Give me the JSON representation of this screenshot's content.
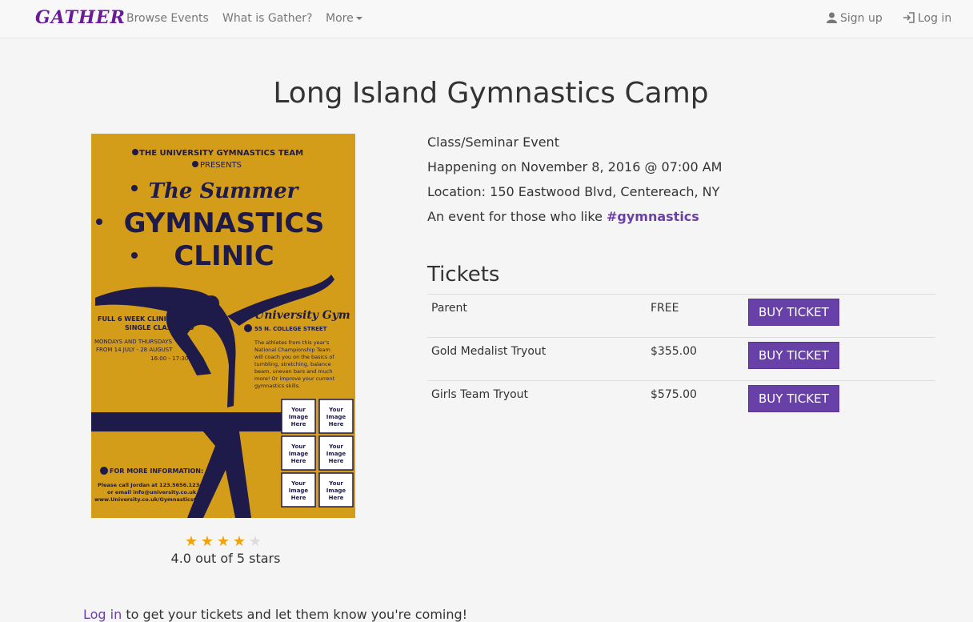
{
  "navbar": {
    "brand": "GATHER",
    "links": [
      "Browse Events",
      "What is Gather?",
      "More"
    ],
    "signup": "Sign up",
    "login": "Log in"
  },
  "event": {
    "title": "Long Island Gymnastics Camp",
    "category": "Class/Seminar Event",
    "happening": "Happening on November 8, 2016 @ 07:00 AM",
    "location": "Location: 150 Eastwood Blvd, Centereach, NY",
    "tag_prefix": "An event for those who like ",
    "tag": "#gymnastics"
  },
  "poster": {
    "line1": "THE UNIVERSITY GYMNASTICS TEAM",
    "line2": "PRESENTS",
    "line3": "The Summer",
    "line4": "GYMNASTICS",
    "line5": "CLINIC",
    "clinic1": "FULL 6 WEEK CLINIC: £100",
    "clinic2": "SINGLE CLASS: £10",
    "days1": "MONDAYS AND THURSDAYS",
    "days2": "FROM 14 JULY - 28 AUGUST",
    "days3": "16:00 - 17:30",
    "venue": "University Gym",
    "street": "55 N. COLLEGE STREET",
    "blurb": [
      "The athletes from this year's",
      "National Championship Team",
      "will coach you on the basics of",
      "tumbling, stretching, balance",
      "beam, uneven bars and much",
      "more! Or improve your current",
      "gymnastics skills."
    ],
    "info_title": "FOR MORE INFORMATION:",
    "info1": "Please call Jordan at 123.5656.1234",
    "info2": "or email info@university.co.uk",
    "info3": "www.University.co.uk/GymnasticsClinic",
    "placeholder": [
      "Your",
      "Image",
      "Here"
    ],
    "background_color": "#d9a21b",
    "ink_color": "#1e1a4a"
  },
  "rating": {
    "value": 4,
    "max": 5,
    "text": "4.0 out of 5 stars"
  },
  "tickets": {
    "heading": "Tickets",
    "rows": [
      {
        "name": "Parent",
        "price": "FREE",
        "button": "BUY TICKET"
      },
      {
        "name": "Gold Medalist Tryout",
        "price": "$355.00",
        "button": "BUY TICKET"
      },
      {
        "name": "Girls Team Tryout",
        "price": "$575.00",
        "button": "BUY TICKET"
      }
    ]
  },
  "login_prompt": {
    "link": "Log in",
    "rest": " to get your tickets and let them know you're coming!"
  },
  "colors": {
    "accent": "#6841a8",
    "brand": "#6a1b9a",
    "star": "#f0a30a"
  }
}
